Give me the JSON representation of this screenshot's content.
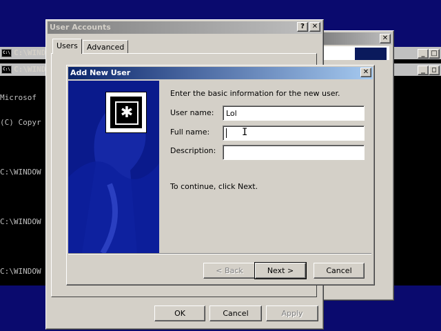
{
  "console_windows": [
    {
      "title": "C:\\WINDOWS"
    },
    {
      "title": "C:\\WINDOWS",
      "lines": [
        "Microsof",
        "(C) Copyr",
        "",
        "C:\\WINDOW",
        "",
        "C:\\WINDOW",
        "",
        "C:\\WINDOW"
      ]
    }
  ],
  "user_accounts": {
    "title": "User Accounts",
    "help_glyph": "?",
    "close_glyph": "✕",
    "tabs": [
      "Users",
      "Advanced"
    ],
    "ok_label": "OK",
    "cancel_label": "Cancel",
    "apply_label": "Apply"
  },
  "wizard": {
    "title": "Add New User",
    "close_glyph": "✕",
    "intro": "Enter the basic information for the new user.",
    "username_label": "User name:",
    "username_value": "Lol",
    "fullname_label": "Full name:",
    "fullname_value": "",
    "description_label": "Description:",
    "description_value": "",
    "continue_text": "To continue, click Next.",
    "back_label": "< Back",
    "next_label": "Next >",
    "cancel_label": "Cancel",
    "colors": {
      "banner": "#0a1a8c",
      "title_active": "#0a246a"
    }
  }
}
